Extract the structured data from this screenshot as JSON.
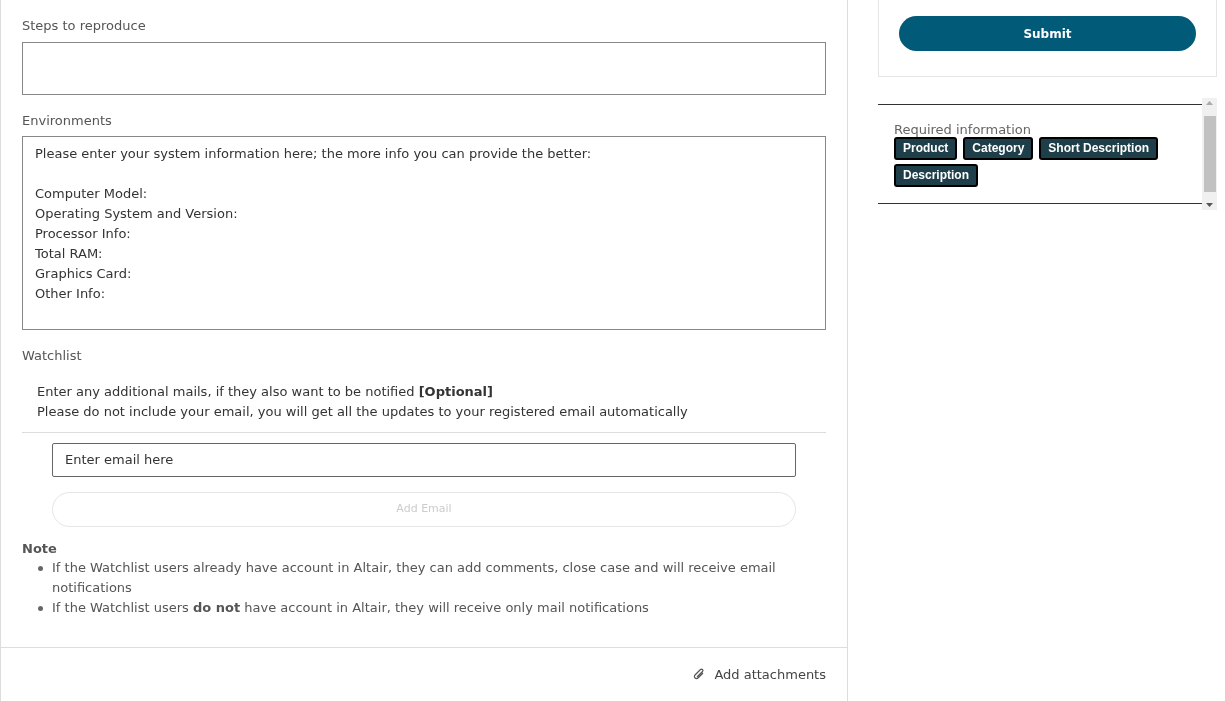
{
  "form": {
    "steps_to_reproduce": {
      "label": "Steps to reproduce"
    },
    "environments": {
      "label": "Environments",
      "intro": "Please enter your system information here; the more info you can provide the better:",
      "lines": [
        "Computer Model:",
        "Operating System and Version:",
        "Processor Info:",
        "Total RAM:",
        "Graphics Card:",
        "Other Info:"
      ]
    },
    "watchlist": {
      "label": "Watchlist",
      "info": [
        "Enter any additional mails, if they also want to be notified **[Optional]**",
        "Please do not include your email, you will get all the updates to your registered email automatically"
      ],
      "email_field": {
        "placeholder": "Enter email here"
      },
      "add_email_button": {
        "label": "Add Email",
        "disabled": true
      }
    },
    "note": {
      "title": "Note",
      "items": [
        "If the Watchlist users already have account in Altair, they can add comments, close case and will receive email notifications",
        "If the Watchlist users **do not** have account in Altair, they will receive only mail notifications"
      ]
    },
    "add_attachments": "Add attachments"
  },
  "sidebar": {
    "submit_button": "Submit",
    "required_information": {
      "title": "Required information",
      "tags": [
        "Product",
        "Category",
        "Short Description",
        "Description"
      ]
    }
  }
}
